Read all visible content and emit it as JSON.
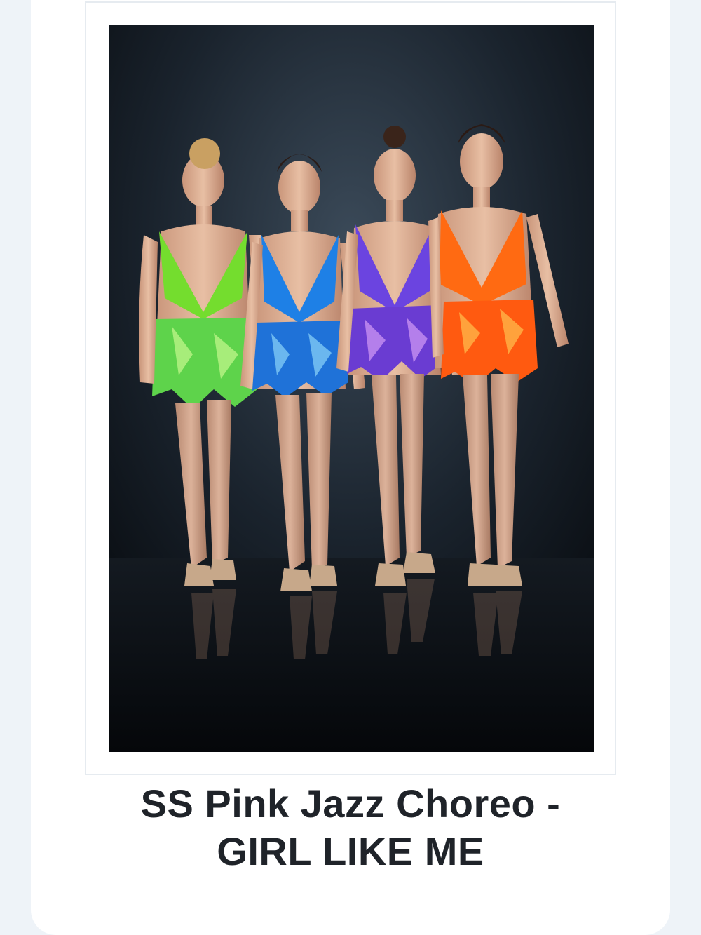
{
  "product": {
    "title_line_1": "SS Pink Jazz Choreo -",
    "title_line_2": "GIRL LIKE ME",
    "image": {
      "subject": "four-dancers-in-sequin-costumes",
      "costume_colors": [
        "#7be12f",
        "#1c7ee8",
        "#6b3fe0",
        "#ff6a12"
      ],
      "background_color": "#0d1219"
    }
  }
}
